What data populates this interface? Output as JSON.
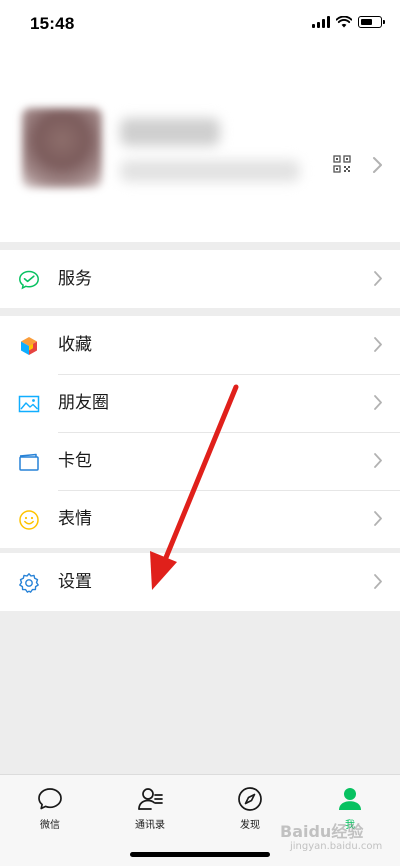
{
  "status_bar": {
    "time": "15:48"
  },
  "menu": {
    "services": {
      "label": "服务",
      "icon": "wechat-pay-icon",
      "color": "#07c160"
    },
    "group2": [
      {
        "label": "收藏",
        "icon": "favorites-cube-icon"
      },
      {
        "label": "朋友圈",
        "icon": "moments-image-icon"
      },
      {
        "label": "卡包",
        "icon": "card-wallet-icon"
      },
      {
        "label": "表情",
        "icon": "sticker-smile-icon"
      }
    ],
    "settings": {
      "label": "设置",
      "icon": "gear-icon"
    }
  },
  "tabbar": [
    {
      "label": "微信",
      "icon": "chat-bubble-icon"
    },
    {
      "label": "通讯录",
      "icon": "contacts-icon"
    },
    {
      "label": "发现",
      "icon": "compass-icon"
    },
    {
      "label": "我",
      "icon": "person-icon",
      "active": true
    }
  ],
  "colors": {
    "accent": "#07c160",
    "annotation_arrow": "#e0201b"
  },
  "watermark": {
    "brand": "Baidu经验",
    "sub": "jingyan.baidu.com"
  }
}
